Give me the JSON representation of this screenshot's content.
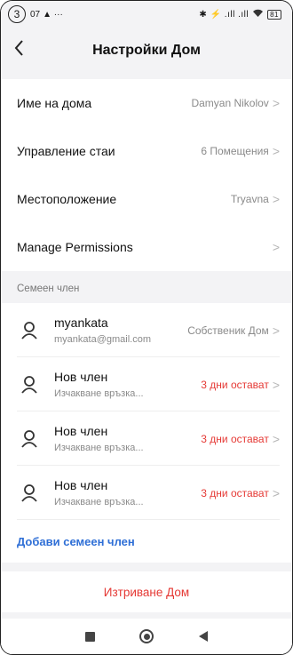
{
  "status_bar": {
    "step_number": "3",
    "time": "07",
    "left_icons": "▲ ···",
    "right_icons": "✱ ⚡ .ıll .ıll",
    "battery": "81"
  },
  "header": {
    "back_icon": "chevron-left-icon",
    "title": "Настройки Дом"
  },
  "settings": [
    {
      "label": "Име на дома",
      "value": "Damyan Nikolov"
    },
    {
      "label": "Управление стаи",
      "value": "6 Помещения"
    },
    {
      "label": "Местоположение",
      "value": "Tryavna"
    },
    {
      "label": "Manage Permissions",
      "value": ""
    }
  ],
  "family": {
    "section_title": "Семеен член",
    "members": [
      {
        "name": "myankata",
        "sub": "myankata@gmail.com",
        "status": "Собственик Дом",
        "status_color": "#8a8a8a"
      },
      {
        "name": "Нов член",
        "sub": "Изчакване връзка...",
        "status": "3 дни остават",
        "status_color": "#e53935"
      },
      {
        "name": "Нов член",
        "sub": "Изчакване връзка...",
        "status": "3 дни остават",
        "status_color": "#e53935"
      },
      {
        "name": "Нов член",
        "sub": "Изчакване връзка...",
        "status": "3 дни остават",
        "status_color": "#e53935"
      }
    ],
    "add_label": "Добави семеен член"
  },
  "delete_label": "Изтриване Дом",
  "colors": {
    "accent_blue": "#2f6fd6",
    "danger_red": "#e53935",
    "background": "#f3f3f5"
  }
}
